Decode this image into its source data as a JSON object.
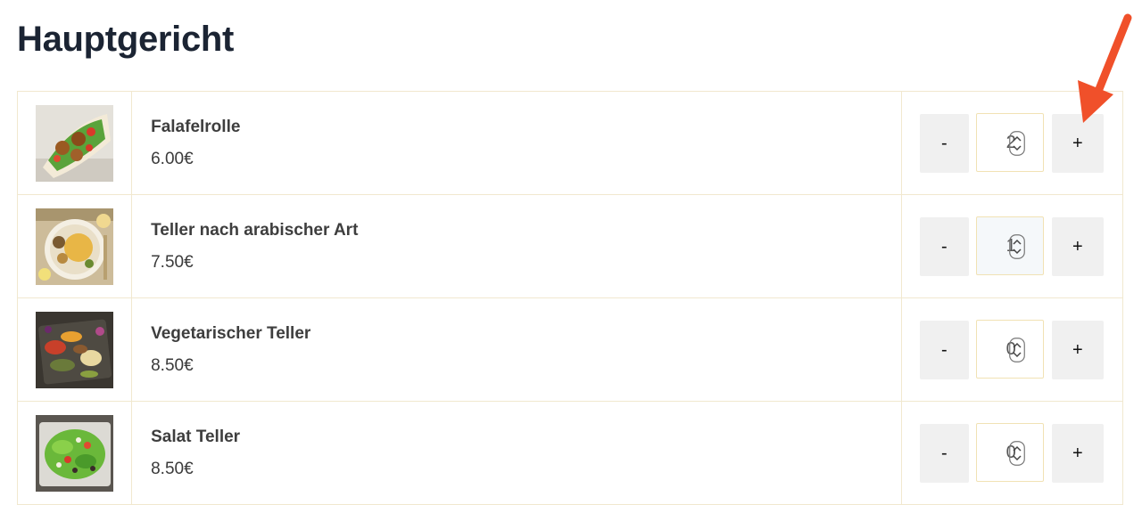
{
  "section": {
    "title": "Hauptgericht"
  },
  "items": [
    {
      "name": "Falafelrolle",
      "price": "6.00€",
      "quantity": "2",
      "minus_label": "-",
      "plus_label": "+",
      "image": "falafel-wrap-image"
    },
    {
      "name": "Teller nach arabischer Art",
      "price": "7.50€",
      "quantity": "1",
      "minus_label": "-",
      "plus_label": "+",
      "image": "arabic-plate-image"
    },
    {
      "name": "Vegetarischer Teller",
      "price": "8.50€",
      "quantity": "0",
      "minus_label": "-",
      "plus_label": "+",
      "image": "vegetarian-plate-image"
    },
    {
      "name": "Salat Teller",
      "price": "8.50€",
      "quantity": "0",
      "minus_label": "-",
      "plus_label": "+",
      "image": "salad-plate-image"
    }
  ],
  "annotation": {
    "arrow_color": "#f0502a",
    "icon": "red-arrow-pointing-to-plus-button"
  }
}
